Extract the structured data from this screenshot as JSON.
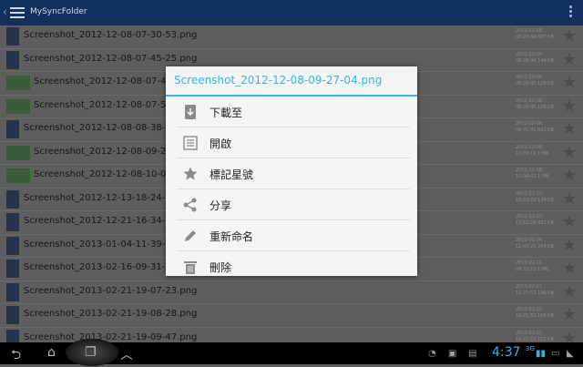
{
  "app": {
    "title": "MySyncFolder"
  },
  "files": [
    {
      "name": "Screenshot_2012-12-08-07-30-53.png",
      "date": "2012-12-08",
      "info": "08:20:44 607 KB",
      "thumb": "tall"
    },
    {
      "name": "Screenshot_2012-12-08-07-45-25.png",
      "date": "2012-12-08",
      "info": "08:20:44 144 KB",
      "thumb": "tall"
    },
    {
      "name": "Screenshot_2012-12-08-07-47",
      "date": "2012-12-08",
      "info": "08:20:45 128 KB",
      "thumb": "wide"
    },
    {
      "name": "Screenshot_2012-12-08-07-50",
      "date": "2012-12-08",
      "info": "08:20:45 128 KB",
      "thumb": "wide"
    },
    {
      "name": "Screenshot_2012-12-08-08-38-1",
      "date": "2012-12-08",
      "info": "08:41:41 803 KB",
      "thumb": "tall"
    },
    {
      "name": "Screenshot_2012-12-08-09-27",
      "date": "2012-12-08",
      "info": "10:06:19 1 MB",
      "thumb": "wide"
    },
    {
      "name": "Screenshot_2012-12-08-10-02",
      "date": "2012-12-08",
      "info": "10:04:42 1 MB",
      "thumb": "wide"
    },
    {
      "name": "Screenshot_2012-12-13-18-24-5",
      "date": "2012-12-13",
      "info": "18:33:20 134 KB",
      "thumb": "tall"
    },
    {
      "name": "Screenshot_2012-12-21-16-34-3",
      "date": "2012-12-23",
      "info": "17:52:29 431 KB",
      "thumb": "tall"
    },
    {
      "name": "Screenshot_2013-01-04-11-39-4",
      "date": "2013-01-04",
      "info": "11:40:23 264 KB",
      "thumb": "tall"
    },
    {
      "name": "Screenshot_2013-02-16-09-31-0",
      "date": "2013-02-16",
      "info": "09:32:12 1 MB",
      "thumb": "tall"
    },
    {
      "name": "Screenshot_2013-02-21-19-07-23.png",
      "date": "2013-02-21",
      "info": "19:21:53 136 KB",
      "thumb": "tall"
    },
    {
      "name": "Screenshot_2013-02-21-19-08-28.png",
      "date": "2013-02-21",
      "info": "19:21:52 168 KB",
      "thumb": "tall"
    },
    {
      "name": "Screenshot_2013-02-21-19-09-47.png",
      "date": "2013-02-21",
      "info": "19:21:53 111 KB",
      "thumb": "tall"
    }
  ],
  "dialog": {
    "title": "Screenshot_2012-12-08-09-27-04.png",
    "items": [
      {
        "label": "下載至",
        "icon": "download-icon"
      },
      {
        "label": "開啟",
        "icon": "open-icon"
      },
      {
        "label": "標記星號",
        "icon": "star-icon"
      },
      {
        "label": "分享",
        "icon": "share-icon"
      },
      {
        "label": "重新命名",
        "icon": "pencil-icon"
      },
      {
        "label": "刪除",
        "icon": "trash-icon"
      }
    ]
  },
  "status": {
    "time": "4:37",
    "network": "3G"
  },
  "colors": {
    "accent": "#33b5e5",
    "actionbar": "#11305b"
  }
}
